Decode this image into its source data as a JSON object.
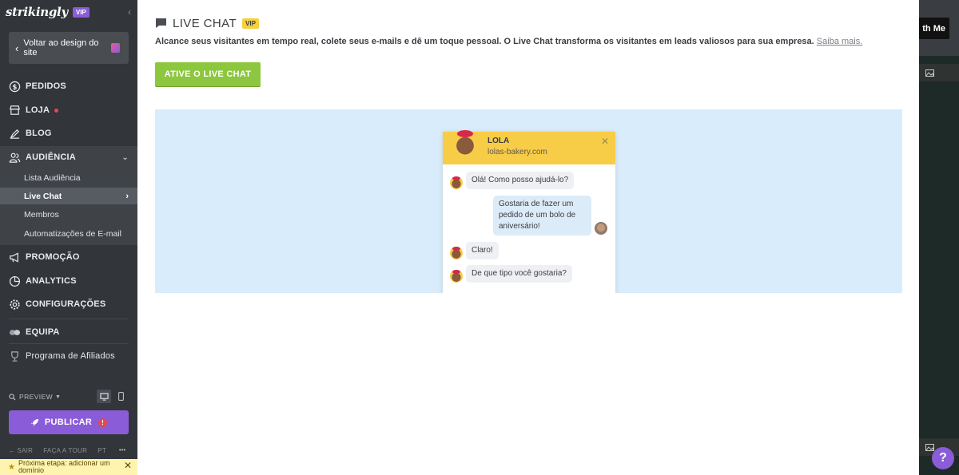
{
  "sidebar": {
    "brand": "strikingly",
    "brand_vip": "VIP",
    "back_label": "Voltar ao design do site",
    "nav": {
      "pedidos": "PEDIDOS",
      "loja": "LOJA",
      "blog": "BLOG",
      "audiencia": "AUDIÊNCIA",
      "promocao": "PROMOÇÃO",
      "analytics": "ANALYTICS",
      "configuracoes": "CONFIGURAÇÕES",
      "equipa": "EQUIPA",
      "afiliados": "Programa de Afiliados"
    },
    "sub": {
      "lista": "Lista Audiência",
      "live_chat": "Live Chat",
      "membros": "Membros",
      "automatizacoes": "Automatizações de E-mail"
    },
    "preview_label": "PREVIEW",
    "publish_label": "PUBLICAR",
    "publish_alert": "!",
    "footer": {
      "sair": "SAIR",
      "tour": "FAÇA A TOUR",
      "lang": "PT",
      "more": "•••"
    },
    "next_step": "Próxima etapa: adicionar um domínio"
  },
  "main": {
    "title": "LIVE CHAT",
    "vip": "VIP",
    "description": "Alcance seus visitantes em tempo real, colete seus e-mails e dê um toque pessoal. O Live Chat transforma os visitantes em leads valiosos para sua empresa.",
    "learn_more": "Saiba mais.",
    "activate_label": "ATIVE O LIVE CHAT",
    "chat": {
      "name": "LOLA",
      "site": "lolas-bakery.com",
      "messages": [
        "Olá! Como posso ajudá-lo?",
        "Gostaria de fazer um pedido de um bolo de aniversário!",
        "Claro!",
        "De que tipo você gostaria?"
      ]
    }
  },
  "backdrop": {
    "button_fragment": "th Me"
  },
  "help_label": "?",
  "colors": {
    "accent_purple": "#8a5cd8",
    "activate_green": "#8dc63f",
    "chat_header_yellow": "#f7cc47",
    "preview_bg": "#d9ecfb"
  }
}
